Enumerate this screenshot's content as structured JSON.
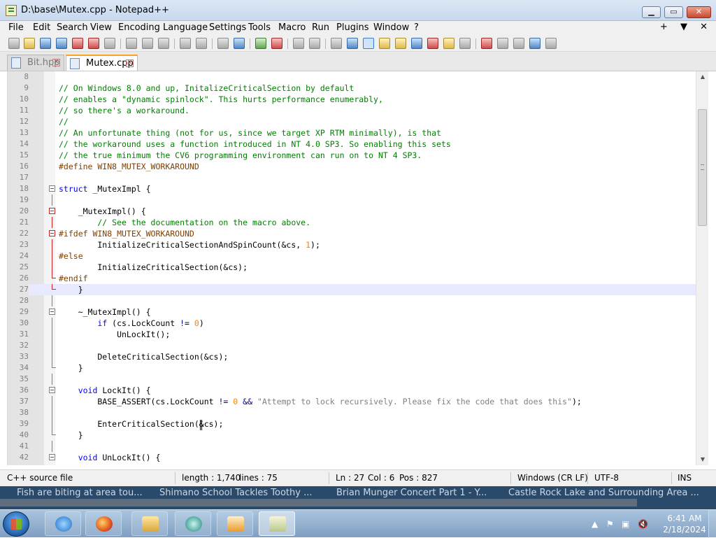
{
  "window": {
    "title": "D:\\base\\Mutex.cpp - Notepad++",
    "min_label": "▁",
    "max_label": "▭",
    "close_label": "✕"
  },
  "menu": {
    "items": [
      "File",
      "Edit",
      "Search",
      "View",
      "Encoding",
      "Language",
      "Settings",
      "Tools",
      "Macro",
      "Run",
      "Plugins",
      "Window",
      "?"
    ],
    "right": [
      "+",
      "▼",
      "✕"
    ]
  },
  "tabs": [
    {
      "label": "Bit.hpp",
      "active": false
    },
    {
      "label": "Mutex.cpp",
      "active": true
    }
  ],
  "tab_close_glyph": "✕",
  "editor": {
    "current_line": 27,
    "lines": [
      {
        "n": "8",
        "t": ""
      },
      {
        "n": "9",
        "t": "// On Windows 8.0 and up, InitalizeCriticalSection by default"
      },
      {
        "n": "10",
        "t": "// enables a \"dynamic spinlock\". This hurts performance enumerably,"
      },
      {
        "n": "11",
        "t": "// so there's a workaround."
      },
      {
        "n": "12",
        "t": "//"
      },
      {
        "n": "13",
        "t": "// An unfortunate thing (not for us, since we target XP RTM minimally), is that"
      },
      {
        "n": "14",
        "t": "// the workaround uses a function introduced in NT 4.0 SP3. So enabling this sets"
      },
      {
        "n": "15",
        "t": "// the true minimum the CV6 programming environment can run on to NT 4 SP3."
      },
      {
        "n": "16",
        "t": "#define WIN8_MUTEX_WORKAROUND"
      },
      {
        "n": "17",
        "t": ""
      },
      {
        "n": "18",
        "t": "struct _MutexImpl {"
      },
      {
        "n": "19",
        "t": ""
      },
      {
        "n": "20",
        "t": "    _MutexImpl() {"
      },
      {
        "n": "21",
        "t": "        // See the documentation on the macro above."
      },
      {
        "n": "22",
        "t": "#ifdef WIN8_MUTEX_WORKAROUND"
      },
      {
        "n": "23",
        "t": "        InitializeCriticalSectionAndSpinCount(&cs, 1);"
      },
      {
        "n": "24",
        "t": "#else"
      },
      {
        "n": "25",
        "t": "        InitializeCriticalSection(&cs);"
      },
      {
        "n": "26",
        "t": "#endif"
      },
      {
        "n": "27",
        "t": "    }"
      },
      {
        "n": "28",
        "t": ""
      },
      {
        "n": "29",
        "t": "    ~_MutexImpl() {"
      },
      {
        "n": "30",
        "t": "        if (cs.LockCount != 0)"
      },
      {
        "n": "31",
        "t": "            UnLockIt();"
      },
      {
        "n": "32",
        "t": ""
      },
      {
        "n": "33",
        "t": "        DeleteCriticalSection(&cs);"
      },
      {
        "n": "34",
        "t": "    }"
      },
      {
        "n": "35",
        "t": ""
      },
      {
        "n": "36",
        "t": "    void LockIt() {"
      },
      {
        "n": "37",
        "t": "        BASE_ASSERT(cs.LockCount != 0 && \"Attempt to lock recursively. Please fix the code that does this\");"
      },
      {
        "n": "38",
        "t": ""
      },
      {
        "n": "39",
        "t": "        EnterCriticalSection(&cs);"
      },
      {
        "n": "40",
        "t": "    }"
      },
      {
        "n": "41",
        "t": ""
      },
      {
        "n": "42",
        "t": "    void UnLockIt() {"
      }
    ]
  },
  "status": {
    "file_type": "C++ source file",
    "length": "length : 1,740",
    "lines": "lines : 75",
    "ln": "Ln : 27",
    "col": "Col : 6",
    "pos": "Pos : 827",
    "eol": "Windows (CR LF)",
    "encoding": "UTF-8",
    "mode": "INS"
  },
  "ticker": [
    "Fish are biting at area tou...",
    "Shimano School Tackles Toothy ...",
    "Brian Munger Concert Part 1 - Y...",
    "Castle Rock Lake and Surrounding Area ..."
  ],
  "clock": {
    "time": "6:41 AM",
    "date": "2/18/2024"
  },
  "colors": {
    "comment": "#008000",
    "preprocessor": "#804000",
    "keyword": "#0000ff",
    "number": "#ff8000",
    "string": "#808080",
    "current_line": "#e8e8ff"
  }
}
